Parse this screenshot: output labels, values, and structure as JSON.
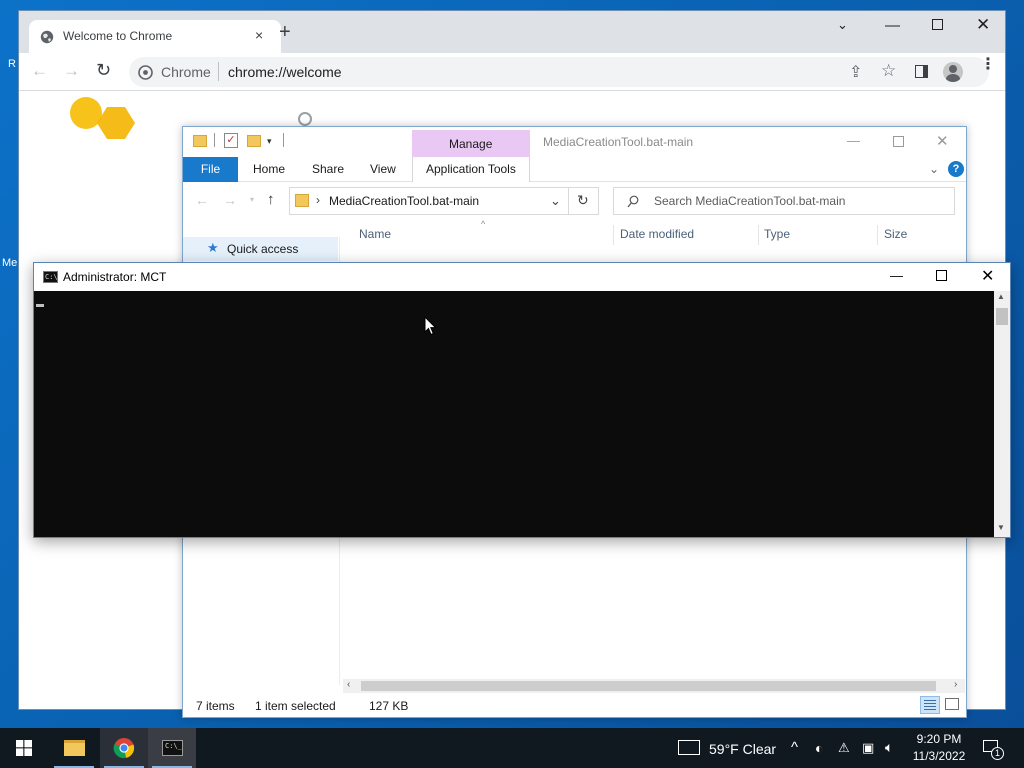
{
  "desktop": {
    "edge_labels": [
      "R",
      "Me"
    ]
  },
  "chrome": {
    "tab_title": "Welcome to Chrome",
    "tab_close": "×",
    "new_tab": "+",
    "omnibox_site": "Chrome",
    "omnibox_url": "chrome://welcome"
  },
  "explorer": {
    "title": "MediaCreationTool.bat-main",
    "manage_label": "Manage",
    "ribbon_tabs": [
      "File",
      "Home",
      "Share",
      "View",
      "Application Tools"
    ],
    "address": "MediaCreationTool.bat-main",
    "search_placeholder": "Search MediaCreationTool.bat-main",
    "nav_quick_access": "Quick access",
    "columns": [
      "Name",
      "Date modified",
      "Type",
      "Size"
    ],
    "status": {
      "items": "7 items",
      "selected": "1 item selected",
      "size": "127 KB"
    }
  },
  "cmd": {
    "title": "Administrator:  MCT"
  },
  "taskbar": {
    "weather": "59°F  Clear",
    "time": "9:20 PM",
    "date": "11/3/2022",
    "notification_count": "1"
  },
  "colors": {
    "desktop": "#0a66b8",
    "manage_tab": "#e9c9f4",
    "file_tab": "#1979ca",
    "cmd_bg": "#0c0c0c",
    "taskbar": "#101820"
  }
}
